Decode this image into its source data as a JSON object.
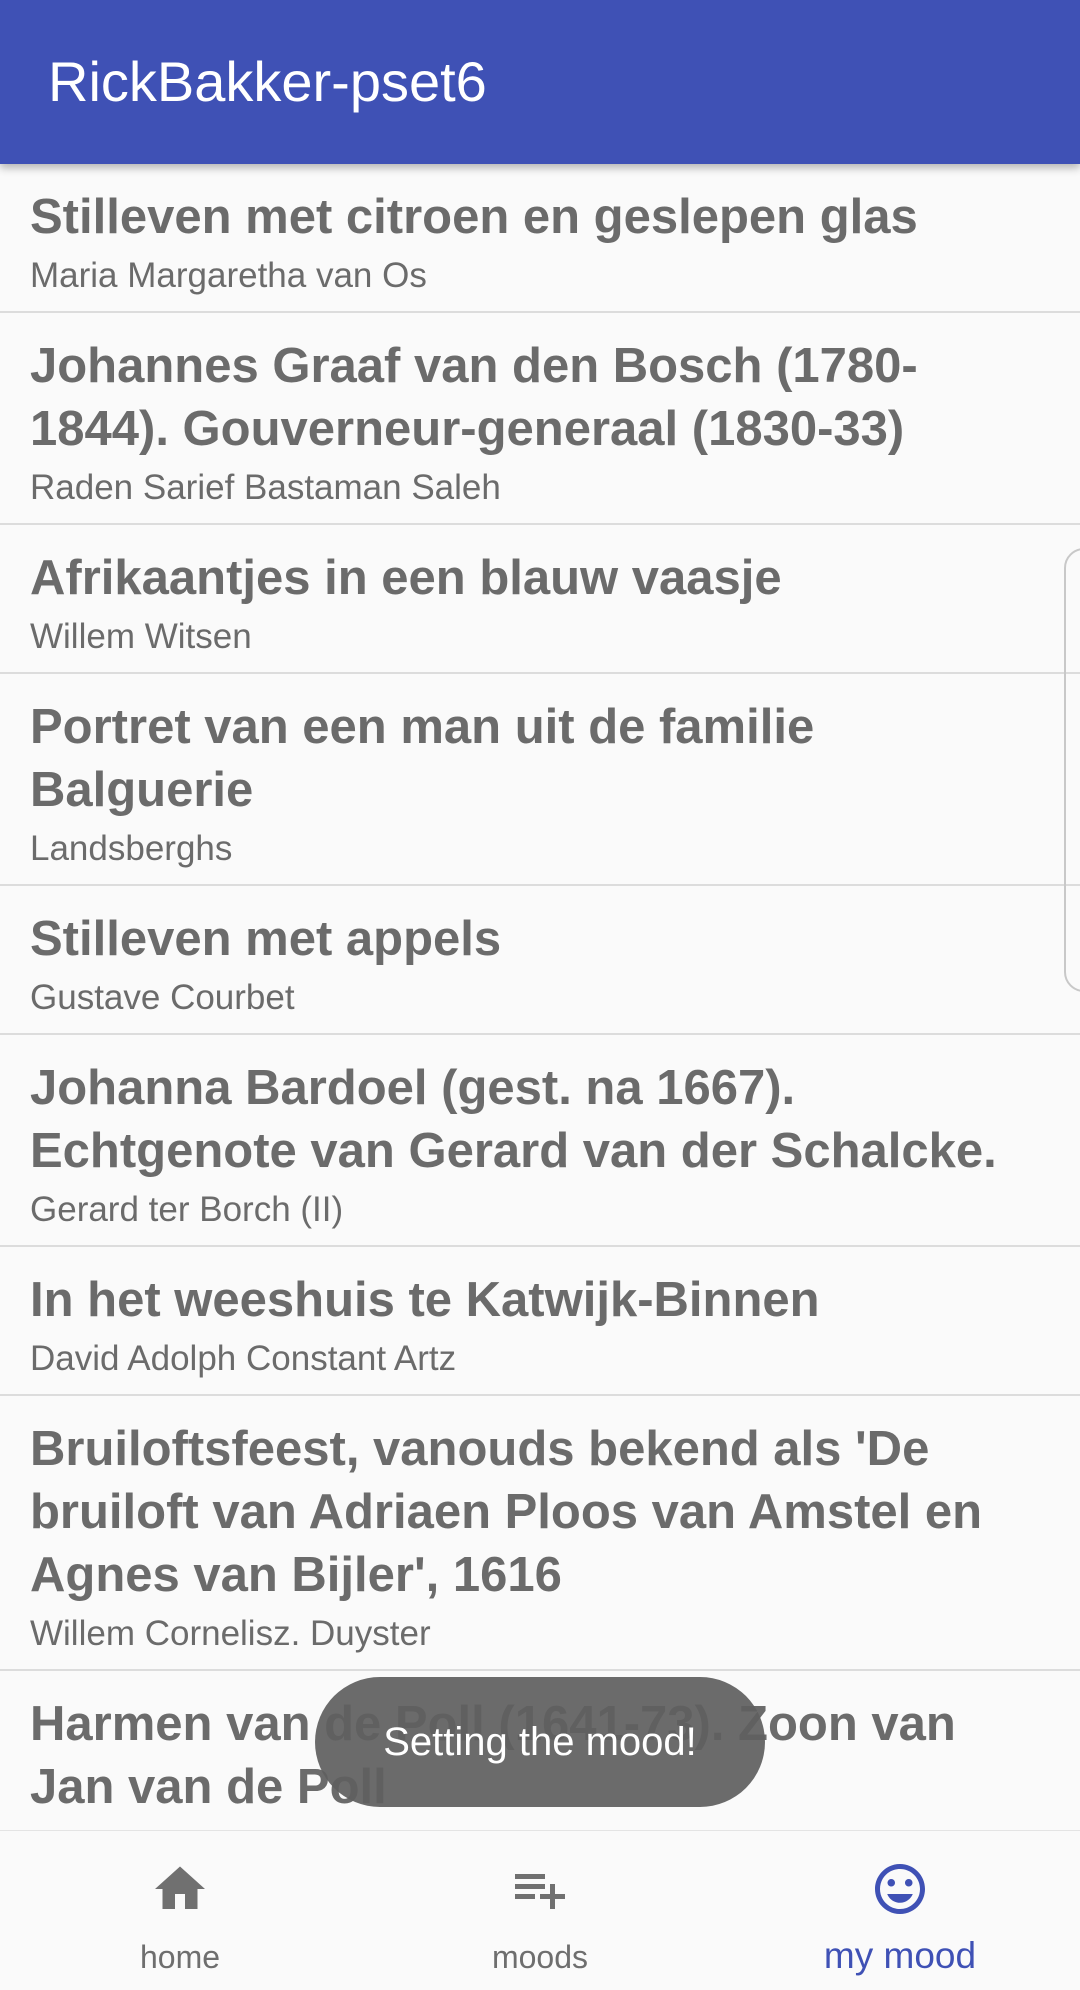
{
  "app_bar": {
    "title": "RickBakker-pset6"
  },
  "artworks": [
    {
      "title": "Stilleven met citroen en geslepen glas",
      "artist": "Maria Margaretha van Os"
    },
    {
      "title": "Johannes Graaf van den Bosch (1780-1844). Gouverneur-generaal (1830-33)",
      "artist": "Raden Sarief Bastaman Saleh"
    },
    {
      "title": "Afrikaantjes in een blauw vaasje",
      "artist": "Willem Witsen"
    },
    {
      "title": "Portret van een man uit de familie Balguerie",
      "artist": "Landsberghs"
    },
    {
      "title": "Stilleven met appels",
      "artist": "Gustave Courbet"
    },
    {
      "title": "Johanna Bardoel (gest. na 1667). Echtgenote van Gerard van der Schalcke.",
      "artist": "Gerard ter Borch (II)"
    },
    {
      "title": "In het weeshuis te Katwijk-Binnen",
      "artist": "David Adolph Constant Artz"
    },
    {
      "title": "Bruiloftsfeest, vanouds bekend als 'De bruiloft van Adriaen Ploos van Amstel en Agnes van Bijler', 1616",
      "artist": "Willem Cornelisz. Duyster"
    },
    {
      "title": "Harmen van de Poll (1641-73). Zoon van Jan van de Poll",
      "artist": ""
    }
  ],
  "toast": {
    "message": "Setting the mood!"
  },
  "bottom_nav": {
    "items": [
      {
        "label": "home",
        "icon": "home-icon",
        "active": false
      },
      {
        "label": "moods",
        "icon": "playlist-add-icon",
        "active": false
      },
      {
        "label": "my mood",
        "icon": "smiley-icon",
        "active": true
      }
    ]
  },
  "colors": {
    "primary": "#3f51b5",
    "text_gray": "#6b6b6b",
    "divider": "#dcdcdc",
    "toast_bg": "#606060"
  }
}
